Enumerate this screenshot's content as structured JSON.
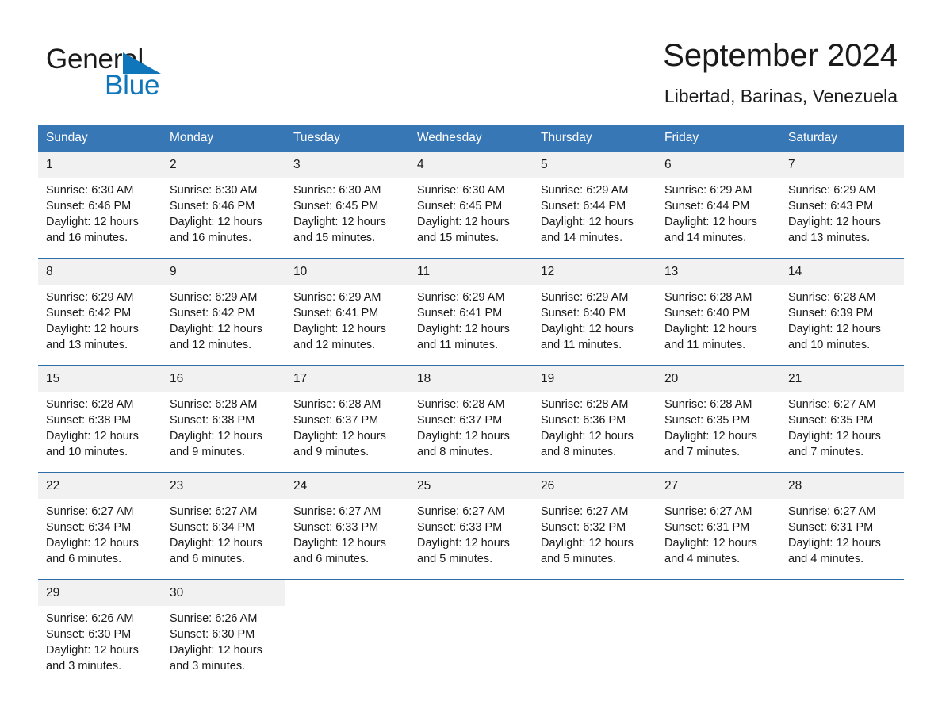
{
  "brand": {
    "name_part1": "General",
    "name_part2": "Blue",
    "triangle_color": "#1076bc"
  },
  "header": {
    "title": "September 2024",
    "subtitle": "Libertad, Barinas, Venezuela"
  },
  "theme": {
    "header_blue": "#3877b6",
    "row_border_blue": "#2e6da8",
    "daynum_band": "#f1f1f1",
    "text": "#1a1a1a"
  },
  "weekday_headers": [
    "Sunday",
    "Monday",
    "Tuesday",
    "Wednesday",
    "Thursday",
    "Friday",
    "Saturday"
  ],
  "labels": {
    "sunrise_prefix": "Sunrise: ",
    "sunset_prefix": "Sunset: ",
    "daylight_prefix": "Daylight: "
  },
  "weeks": [
    [
      {
        "day": "1",
        "sunrise": "Sunrise: 6:30 AM",
        "sunset": "Sunset: 6:46 PM",
        "daylight": "Daylight: 12 hours and 16 minutes."
      },
      {
        "day": "2",
        "sunrise": "Sunrise: 6:30 AM",
        "sunset": "Sunset: 6:46 PM",
        "daylight": "Daylight: 12 hours and 16 minutes."
      },
      {
        "day": "3",
        "sunrise": "Sunrise: 6:30 AM",
        "sunset": "Sunset: 6:45 PM",
        "daylight": "Daylight: 12 hours and 15 minutes."
      },
      {
        "day": "4",
        "sunrise": "Sunrise: 6:30 AM",
        "sunset": "Sunset: 6:45 PM",
        "daylight": "Daylight: 12 hours and 15 minutes."
      },
      {
        "day": "5",
        "sunrise": "Sunrise: 6:29 AM",
        "sunset": "Sunset: 6:44 PM",
        "daylight": "Daylight: 12 hours and 14 minutes."
      },
      {
        "day": "6",
        "sunrise": "Sunrise: 6:29 AM",
        "sunset": "Sunset: 6:44 PM",
        "daylight": "Daylight: 12 hours and 14 minutes."
      },
      {
        "day": "7",
        "sunrise": "Sunrise: 6:29 AM",
        "sunset": "Sunset: 6:43 PM",
        "daylight": "Daylight: 12 hours and 13 minutes."
      }
    ],
    [
      {
        "day": "8",
        "sunrise": "Sunrise: 6:29 AM",
        "sunset": "Sunset: 6:42 PM",
        "daylight": "Daylight: 12 hours and 13 minutes."
      },
      {
        "day": "9",
        "sunrise": "Sunrise: 6:29 AM",
        "sunset": "Sunset: 6:42 PM",
        "daylight": "Daylight: 12 hours and 12 minutes."
      },
      {
        "day": "10",
        "sunrise": "Sunrise: 6:29 AM",
        "sunset": "Sunset: 6:41 PM",
        "daylight": "Daylight: 12 hours and 12 minutes."
      },
      {
        "day": "11",
        "sunrise": "Sunrise: 6:29 AM",
        "sunset": "Sunset: 6:41 PM",
        "daylight": "Daylight: 12 hours and 11 minutes."
      },
      {
        "day": "12",
        "sunrise": "Sunrise: 6:29 AM",
        "sunset": "Sunset: 6:40 PM",
        "daylight": "Daylight: 12 hours and 11 minutes."
      },
      {
        "day": "13",
        "sunrise": "Sunrise: 6:28 AM",
        "sunset": "Sunset: 6:40 PM",
        "daylight": "Daylight: 12 hours and 11 minutes."
      },
      {
        "day": "14",
        "sunrise": "Sunrise: 6:28 AM",
        "sunset": "Sunset: 6:39 PM",
        "daylight": "Daylight: 12 hours and 10 minutes."
      }
    ],
    [
      {
        "day": "15",
        "sunrise": "Sunrise: 6:28 AM",
        "sunset": "Sunset: 6:38 PM",
        "daylight": "Daylight: 12 hours and 10 minutes."
      },
      {
        "day": "16",
        "sunrise": "Sunrise: 6:28 AM",
        "sunset": "Sunset: 6:38 PM",
        "daylight": "Daylight: 12 hours and 9 minutes."
      },
      {
        "day": "17",
        "sunrise": "Sunrise: 6:28 AM",
        "sunset": "Sunset: 6:37 PM",
        "daylight": "Daylight: 12 hours and 9 minutes."
      },
      {
        "day": "18",
        "sunrise": "Sunrise: 6:28 AM",
        "sunset": "Sunset: 6:37 PM",
        "daylight": "Daylight: 12 hours and 8 minutes."
      },
      {
        "day": "19",
        "sunrise": "Sunrise: 6:28 AM",
        "sunset": "Sunset: 6:36 PM",
        "daylight": "Daylight: 12 hours and 8 minutes."
      },
      {
        "day": "20",
        "sunrise": "Sunrise: 6:28 AM",
        "sunset": "Sunset: 6:35 PM",
        "daylight": "Daylight: 12 hours and 7 minutes."
      },
      {
        "day": "21",
        "sunrise": "Sunrise: 6:27 AM",
        "sunset": "Sunset: 6:35 PM",
        "daylight": "Daylight: 12 hours and 7 minutes."
      }
    ],
    [
      {
        "day": "22",
        "sunrise": "Sunrise: 6:27 AM",
        "sunset": "Sunset: 6:34 PM",
        "daylight": "Daylight: 12 hours and 6 minutes."
      },
      {
        "day": "23",
        "sunrise": "Sunrise: 6:27 AM",
        "sunset": "Sunset: 6:34 PM",
        "daylight": "Daylight: 12 hours and 6 minutes."
      },
      {
        "day": "24",
        "sunrise": "Sunrise: 6:27 AM",
        "sunset": "Sunset: 6:33 PM",
        "daylight": "Daylight: 12 hours and 6 minutes."
      },
      {
        "day": "25",
        "sunrise": "Sunrise: 6:27 AM",
        "sunset": "Sunset: 6:33 PM",
        "daylight": "Daylight: 12 hours and 5 minutes."
      },
      {
        "day": "26",
        "sunrise": "Sunrise: 6:27 AM",
        "sunset": "Sunset: 6:32 PM",
        "daylight": "Daylight: 12 hours and 5 minutes."
      },
      {
        "day": "27",
        "sunrise": "Sunrise: 6:27 AM",
        "sunset": "Sunset: 6:31 PM",
        "daylight": "Daylight: 12 hours and 4 minutes."
      },
      {
        "day": "28",
        "sunrise": "Sunrise: 6:27 AM",
        "sunset": "Sunset: 6:31 PM",
        "daylight": "Daylight: 12 hours and 4 minutes."
      }
    ],
    [
      {
        "day": "29",
        "sunrise": "Sunrise: 6:26 AM",
        "sunset": "Sunset: 6:30 PM",
        "daylight": "Daylight: 12 hours and 3 minutes."
      },
      {
        "day": "30",
        "sunrise": "Sunrise: 6:26 AM",
        "sunset": "Sunset: 6:30 PM",
        "daylight": "Daylight: 12 hours and 3 minutes."
      },
      {
        "day": "",
        "sunrise": "",
        "sunset": "",
        "daylight": ""
      },
      {
        "day": "",
        "sunrise": "",
        "sunset": "",
        "daylight": ""
      },
      {
        "day": "",
        "sunrise": "",
        "sunset": "",
        "daylight": ""
      },
      {
        "day": "",
        "sunrise": "",
        "sunset": "",
        "daylight": ""
      },
      {
        "day": "",
        "sunrise": "",
        "sunset": "",
        "daylight": ""
      }
    ]
  ]
}
